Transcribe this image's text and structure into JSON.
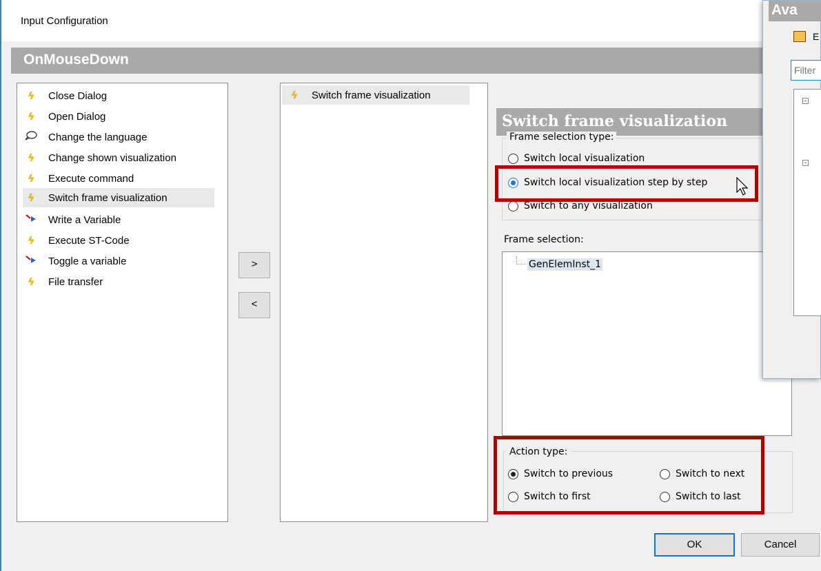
{
  "window": {
    "title": "Input Configuration"
  },
  "event_header": "OnMouseDown",
  "actions": [
    {
      "label": "Close Dialog",
      "icon": "lightning-icon"
    },
    {
      "label": "Open Dialog",
      "icon": "lightning-icon"
    },
    {
      "label": "Change the language",
      "icon": "speech-bubble-icon"
    },
    {
      "label": "Change shown visualization",
      "icon": "lightning-icon"
    },
    {
      "label": "Execute command",
      "icon": "lightning-icon"
    },
    {
      "label": "Switch frame visualization",
      "icon": "lightning-icon",
      "selected": true
    },
    {
      "label": "Write a Variable",
      "icon": "variable-arrow-icon"
    },
    {
      "label": "Execute ST-Code",
      "icon": "lightning-icon"
    },
    {
      "label": "Toggle a variable",
      "icon": "variable-arrow-icon"
    },
    {
      "label": "File transfer",
      "icon": "lightning-icon"
    }
  ],
  "buttons": {
    "add": ">",
    "remove": "<",
    "ok": "OK",
    "cancel": "Cancel"
  },
  "assigned": [
    {
      "label": "Switch frame visualization",
      "icon": "lightning-icon"
    }
  ],
  "detail": {
    "title": "Switch frame visualization",
    "frame_selection_type": {
      "label": "Frame selection type:",
      "options": [
        "Switch local visualization",
        "Switch local visualization step by step",
        "Switch to any visualization"
      ],
      "selected": "Switch local visualization step by step"
    },
    "frame_selection": {
      "label": "Frame selection:",
      "items": [
        "GenElemInst_1"
      ]
    },
    "action_type": {
      "label": "Action type:",
      "options": [
        "Switch to previous",
        "Switch to next",
        "Switch to first",
        "Switch to last"
      ],
      "selected": "Switch to previous"
    }
  },
  "side_window": {
    "title": "Ava",
    "toolbar_text": "E",
    "filter_placeholder": "Filter"
  },
  "colors": {
    "highlight": "#b00000",
    "header_gray": "#a9a9a9",
    "radio_blue": "#1c77d2"
  }
}
